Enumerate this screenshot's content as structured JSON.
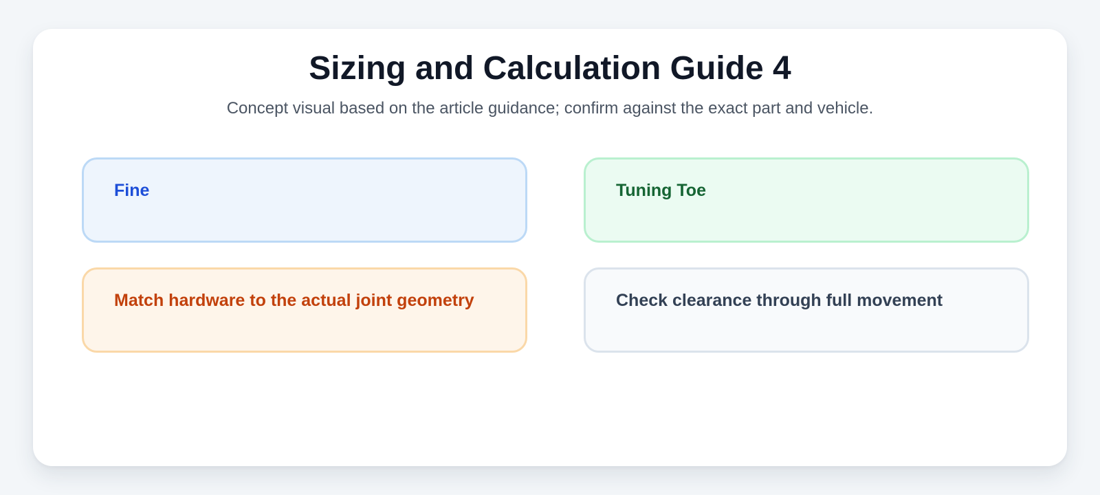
{
  "header": {
    "title": "Sizing and Calculation Guide 4",
    "subtitle": "Concept visual based on the article guidance; confirm against the exact part and vehicle."
  },
  "panels": [
    {
      "label": "Fine",
      "theme": "blue",
      "text_color": "#1d4ed8",
      "background": "#eef5fd",
      "border": "#bcd9f6"
    },
    {
      "label": "Tuning Toe",
      "theme": "green",
      "text_color": "#166534",
      "background": "#ebfbf2",
      "border": "#b9f0cf"
    },
    {
      "label": "Match hardware to the actual joint geometry",
      "theme": "orange",
      "text_color": "#c2410c",
      "background": "#fef5ea",
      "border": "#fad8a8"
    },
    {
      "label": "Check clearance through full movement",
      "theme": "gray",
      "text_color": "#334155",
      "background": "#f8fafc",
      "border": "#dbe3ec"
    }
  ]
}
